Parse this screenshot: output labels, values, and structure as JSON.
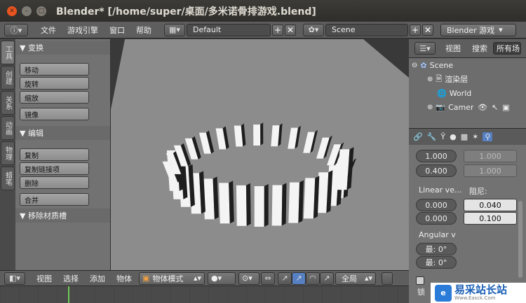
{
  "window": {
    "title": "Blender* [/home/super/桌面/多米诺骨排游戏.blend]"
  },
  "info_header": {
    "menus": [
      "文件",
      "游戏引擎",
      "窗口",
      "帮助"
    ],
    "layout": "Default",
    "scene": "Scene",
    "engine": "Blender 游戏"
  },
  "tool_tabs": [
    "工具",
    "创建",
    "关系",
    "动画",
    "物理",
    "蜡笔"
  ],
  "tool_shelf": {
    "transform_title": "▼ 变换",
    "transform_buttons": [
      "移动",
      "旋转",
      "缩放"
    ],
    "mirror": "镜像",
    "edit_title": "▼ 编辑",
    "edit_buttons": [
      "复制",
      "复制链接项",
      "删除"
    ],
    "join": "合并",
    "remove_material_title": "▼ 移除材质槽"
  },
  "outliner": {
    "view_label": "视图",
    "search_label": "搜索",
    "all_scenes": "所有场",
    "rows": [
      "Scene",
      "渲染层",
      "World",
      "Camera"
    ]
  },
  "properties": {
    "val_a1": "1.000",
    "val_a2": "0.400",
    "val_b1": "1.000",
    "val_b2": "1.000",
    "linear_label": "Linear ve...",
    "damping_label": "阻尼:",
    "lin_x": "0.000",
    "lin_y": "0.000",
    "damp_1": "0.040",
    "damp_2": "0.100",
    "angular_label": "Angular v",
    "ang_min": "最: 0°",
    "ang_max": "最: 0°",
    "lock_label": "锁"
  },
  "view3d_header": {
    "menus": [
      "视图",
      "选择",
      "添加",
      "物体"
    ],
    "mode": "物体模式",
    "orientation": "全局"
  },
  "watermark": {
    "brand": "易采站长站",
    "url": "Www.Easck.Com"
  },
  "colors": {
    "accent": "#4d80c2",
    "close_button": "#e9541f",
    "selection_blue": "#5680c2"
  }
}
